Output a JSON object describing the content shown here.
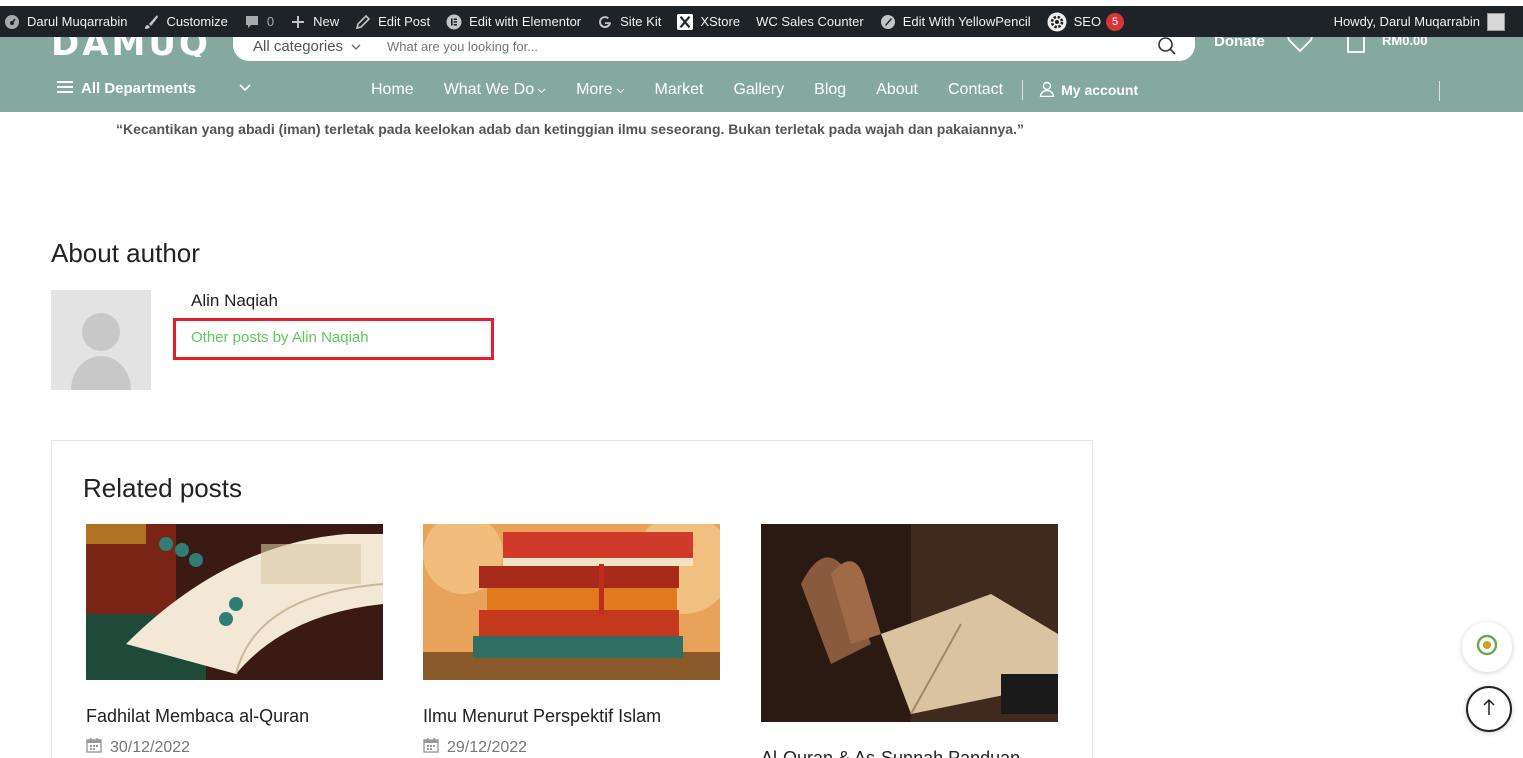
{
  "adminbar": {
    "site_name": "Darul Muqarrabin",
    "customize": "Customize",
    "comments_count": "0",
    "new": "New",
    "edit_post": "Edit Post",
    "edit_elementor": "Edit with Elementor",
    "site_kit": "Site Kit",
    "xstore": "XStore",
    "wc_sales": "WC Sales Counter",
    "yellowpencil": "Edit With YellowPencil",
    "seo": "SEO",
    "seo_count": "5",
    "howdy": "Howdy, Darul Muqarrabin"
  },
  "header": {
    "logo": "DAMUQ",
    "search_category": "All categories",
    "search_placeholder": "What are you looking for...",
    "donate": "Donate",
    "cart_amount": "RM0.00",
    "accent": "#85a99e"
  },
  "nav": {
    "departments": "All Departments",
    "items": [
      "Home",
      "What We Do",
      "More",
      "Market",
      "Gallery",
      "Blog",
      "About",
      "Contact"
    ],
    "account": "My account"
  },
  "content": {
    "quote": "“Kecantikan yang abadi (iman) terletak pada keelokan adab dan ketinggian ilmu seseorang. Bukan terletak pada wajah dan pakaiannya.”",
    "about_title": "About author",
    "author_name": "Alin Naqiah",
    "other_posts": "Other posts by Alin Naqiah"
  },
  "related": {
    "title": "Related posts",
    "posts": [
      {
        "title": "Fadhilat Membaca al-Quran",
        "date": "30/12/2022"
      },
      {
        "title": "Ilmu Menurut Perspektif Islam",
        "date": "29/12/2022"
      },
      {
        "title": "Al-Quran & As-Sunnah Panduan",
        "date": ""
      }
    ]
  }
}
